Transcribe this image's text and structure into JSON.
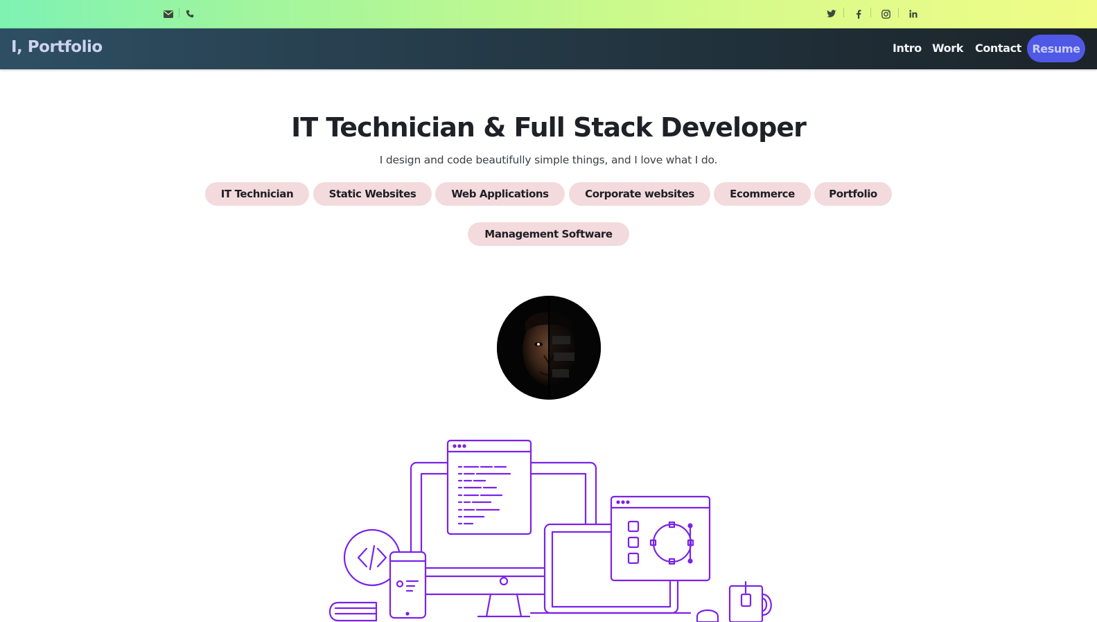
{
  "topbar": {
    "left_icons": [
      "envelope-icon",
      "phone-icon"
    ],
    "social_icons": [
      "twitter-icon",
      "facebook-icon",
      "instagram-icon",
      "linkedin-icon"
    ]
  },
  "nav": {
    "brand": "I, Portfolio",
    "links": [
      {
        "label": "Intro"
      },
      {
        "label": "Work"
      },
      {
        "label": "Contact"
      }
    ],
    "resume_label": "Resume",
    "colors": {
      "resume_bg": "#4f59e6",
      "resume_text": "#c9ccf7",
      "brand_text": "#cdd3ef"
    }
  },
  "hero": {
    "title": "IT Technician & Full Stack Developer",
    "subtitle": "I design and code beautifully simple things, and I love what I do.",
    "tags": [
      {
        "label": "IT Technician"
      },
      {
        "label": "Static Websites"
      },
      {
        "label": "Web Applications"
      },
      {
        "label": "Corporate websites"
      },
      {
        "label": "Ecommerce"
      },
      {
        "label": "Portfolio"
      },
      {
        "label": "Management Software"
      }
    ],
    "tag_color": "#f3dadd"
  },
  "illustration": {
    "name": "developer-workspace-illustration",
    "stroke_color": "#7a22e8"
  }
}
